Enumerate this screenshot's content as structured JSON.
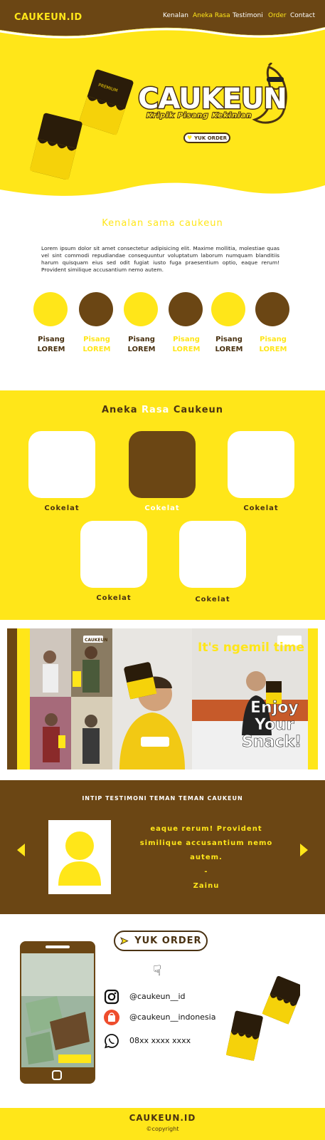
{
  "nav": {
    "brand": "CAUKEUN.ID",
    "links": [
      "Kenalan",
      "Aneka Rasa",
      "Testimoni",
      "Order",
      "Contact"
    ]
  },
  "hero": {
    "title": "CAUKEUN",
    "subtitle": "Kripik Pisang Kekinian",
    "order_label": "YUK ORDER"
  },
  "kenalan": {
    "title": "Kenalan sama caukeun",
    "text": "Lorem ipsum dolor sit amet consectetur adipisicing elit. Maxime mollitia, molestiae quas vel sint commodi repudiandae consequuntur voluptatum laborum numquam blanditiis harum quisquam eius sed odit fugiat iusto fuga praesentium optio, eaque rerum! Provident similique accusantium nemo autem.",
    "items": [
      {
        "line1": "Pisang",
        "line2": "LOREM",
        "circle": "#ffe619",
        "text_color": "#4a3212"
      },
      {
        "line1": "Pisang",
        "line2": "LOREM",
        "circle": "#6b4614",
        "text_color": "#ffe619"
      },
      {
        "line1": "Pisang",
        "line2": "LOREM",
        "circle": "#ffe619",
        "text_color": "#4a3212"
      },
      {
        "line1": "Pisang",
        "line2": "LOREM",
        "circle": "#6b4614",
        "text_color": "#ffe619"
      },
      {
        "line1": "Pisang",
        "line2": "LOREM",
        "circle": "#ffe619",
        "text_color": "#4a3212"
      },
      {
        "line1": "Pisang",
        "line2": "LOREM",
        "circle": "#6b4614",
        "text_color": "#ffe619"
      }
    ]
  },
  "aneka": {
    "title_part1": "Aneka",
    "title_part2": "Rasa",
    "title_part3": "Caukeun",
    "flavors": [
      {
        "label": "Cokelat",
        "tile": "#ffffff",
        "text_color": "#4a3212"
      },
      {
        "label": "Cokelat",
        "tile": "#6b4614",
        "text_color": "#ffffff"
      },
      {
        "label": "Cokelat",
        "tile": "#ffffff",
        "text_color": "#4a3212"
      },
      {
        "label": "Cokelat",
        "tile": "#ffffff",
        "text_color": "#4a3212"
      },
      {
        "label": "Cokelat",
        "tile": "#ffffff",
        "text_color": "#4a3212"
      }
    ]
  },
  "photos": {
    "tag_small": "CAUKEUN",
    "overlay_top": "It's ngemil time",
    "overlay_big": [
      "Enjoy",
      "Your",
      "Snack!"
    ]
  },
  "testimoni": {
    "title": "INTIP TESTIMONI TEMAN TEMAN CAUKEUN",
    "quote": "eaque rerum! Provident similique accusantium nemo autem.",
    "dash": "-",
    "author": "Zainu"
  },
  "order": {
    "button_label": "YUK ORDER",
    "contacts": [
      {
        "icon": "instagram-icon",
        "text": "@caukeun__id"
      },
      {
        "icon": "shopee-icon",
        "text": "@caukeun__indonesia"
      },
      {
        "icon": "whatsapp-icon",
        "text": "08xx xxxx xxxx"
      }
    ]
  },
  "footer": {
    "brand": "CAUKEUN.ID",
    "copyright": "copyright"
  },
  "colors": {
    "yellow": "#ffe619",
    "brown": "#6b4614",
    "dark_brown": "#4a3212"
  }
}
